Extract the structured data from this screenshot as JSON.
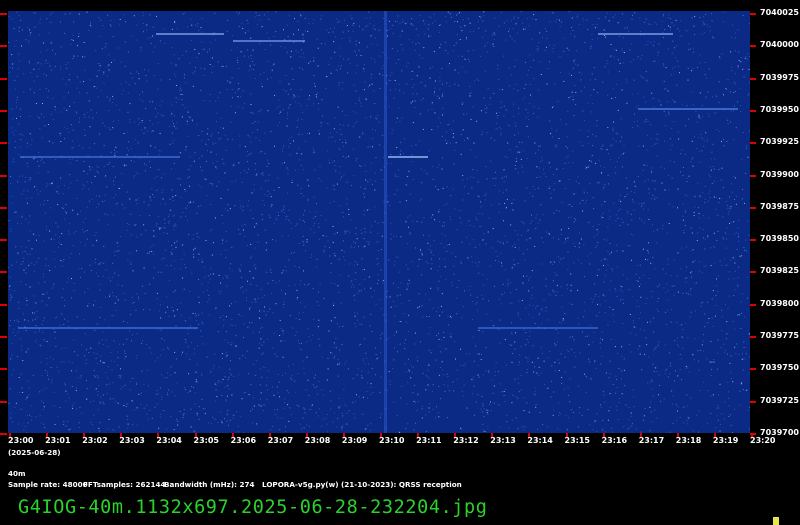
{
  "colors": {
    "background": "#000000",
    "waterfall": "#0a2a86",
    "tick": "#e00000",
    "filename_text": "#2bd22b",
    "marker": "#e6e64a"
  },
  "frequency_labels": [
    "7040025",
    "7040000",
    "7039975",
    "7039950",
    "7039925",
    "7039900",
    "7039875",
    "7039850",
    "7039825",
    "7039800",
    "7039775",
    "7039750",
    "7039725",
    "7039700"
  ],
  "time_labels": [
    "23:00",
    "23:01",
    "23:02",
    "23:03",
    "23:04",
    "23:05",
    "23:06",
    "23:07",
    "23:08",
    "23:09",
    "23:10",
    "23:11",
    "23:12",
    "23:13",
    "23:14",
    "23:15",
    "23:16",
    "23:17",
    "23:18",
    "23:19",
    "23:20"
  ],
  "date_label": "(2025-06-28)",
  "band_label": "40m",
  "info": {
    "sample_rate": "Sample rate: 48000",
    "fft_samples": "FFTsamples: 262144",
    "bandwidth": "Bandwidth (mHz): 274",
    "software": "LOPORA-v5g.py(w) (21-10-2023): QRSS reception"
  },
  "filename": "G4IOG-40m.1132x697.2025-06-28-232204.jpg"
}
